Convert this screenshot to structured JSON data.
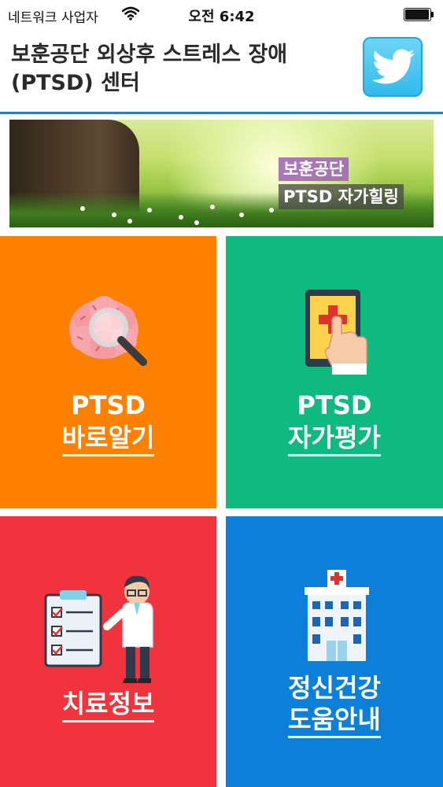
{
  "status": {
    "carrier": "네트워크 사업자",
    "time": "오전 6:42"
  },
  "header": {
    "title": "보훈공단 외상후 스트레스 장애 (PTSD) 센터"
  },
  "banner": {
    "line1": "보훈공단",
    "line2": "PTSD 자가힐링"
  },
  "menu": [
    {
      "line1": "PTSD",
      "line2": "바로알기",
      "color": "#fe8000",
      "icon": "brain-magnifier-icon"
    },
    {
      "line1": "PTSD",
      "line2": "자가평가",
      "color": "#0fba81",
      "icon": "tablet-touch-icon"
    },
    {
      "line1": "",
      "line2": "치료정보",
      "color": "#f0333c",
      "icon": "doctor-checklist-icon"
    },
    {
      "line1": "정신건강",
      "line2": "도움안내",
      "color": "#0c7fd9",
      "icon": "hospital-icon"
    }
  ]
}
